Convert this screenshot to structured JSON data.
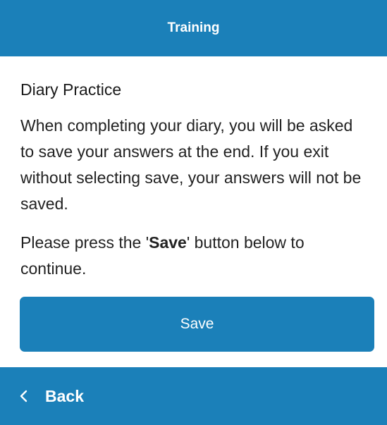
{
  "header": {
    "title": "Training"
  },
  "content": {
    "title": "Diary Practice",
    "paragraph1": "When completing your diary, you will be asked to save your answers at the end. If you exit without selecting save, your answers will not be saved.",
    "paragraph2_prefix": "Please press the '",
    "paragraph2_bold": "Save",
    "paragraph2_suffix": "' button below to continue."
  },
  "save_button": {
    "label": "Save"
  },
  "footer": {
    "back_label": "Back",
    "back_icon": "chevron-left-icon"
  },
  "colors": {
    "primary": "#1b80b9",
    "background": "#ffffff",
    "text": "#222222"
  }
}
